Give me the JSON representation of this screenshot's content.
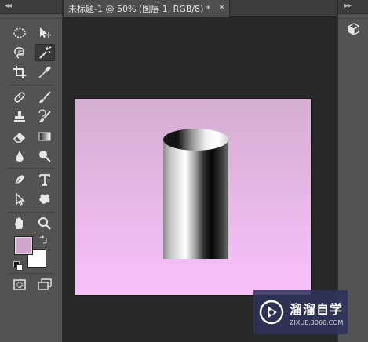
{
  "document": {
    "tab_title": "未标题-1 @ 50% (图层 1, RGB/8) *",
    "close_glyph": "×"
  },
  "toolbar": {
    "collapse_glyph": "◂◂",
    "tools": [
      {
        "name": "rectangular-marquee-tool",
        "icon": "dotted-ellipse-icon"
      },
      {
        "name": "move-tool",
        "icon": "move-arrow-icon"
      },
      {
        "name": "lasso-tool",
        "icon": "lasso-icon"
      },
      {
        "name": "magic-wand-tool",
        "icon": "magic-wand-icon",
        "active": true
      },
      {
        "name": "crop-tool",
        "icon": "crop-icon"
      },
      {
        "name": "eyedropper-tool",
        "icon": "eyedropper-icon"
      },
      {
        "name": "healing-brush-tool",
        "icon": "bandage-icon"
      },
      {
        "name": "brush-tool",
        "icon": "brush-icon"
      },
      {
        "name": "clone-stamp-tool",
        "icon": "stamp-icon"
      },
      {
        "name": "history-brush-tool",
        "icon": "history-brush-icon"
      },
      {
        "name": "eraser-tool",
        "icon": "eraser-icon"
      },
      {
        "name": "gradient-tool",
        "icon": "gradient-icon"
      },
      {
        "name": "blur-tool",
        "icon": "droplet-icon"
      },
      {
        "name": "dodge-tool",
        "icon": "dodge-icon"
      },
      {
        "name": "pen-tool",
        "icon": "pen-nib-icon"
      },
      {
        "name": "type-tool",
        "icon": "type-t-icon"
      },
      {
        "name": "path-selection-tool",
        "icon": "arrow-cursor-icon"
      },
      {
        "name": "custom-shape-tool",
        "icon": "shape-blob-icon"
      },
      {
        "name": "hand-tool",
        "icon": "hand-icon"
      },
      {
        "name": "zoom-tool",
        "icon": "magnifier-icon"
      }
    ],
    "foreground_color": "#cfa7cb",
    "background_color": "#ffffff"
  },
  "right_panel": {
    "collapse_glyph": "▸▸",
    "button_icon": "3d-cube-icon"
  },
  "canvas": {
    "gradient_top": "#d4aed1",
    "gradient_bottom": "#f8c0fb"
  },
  "watermark": {
    "title": "溜溜自学",
    "url": "ZIXUE.3066.COM",
    "background": "#2d325a"
  }
}
